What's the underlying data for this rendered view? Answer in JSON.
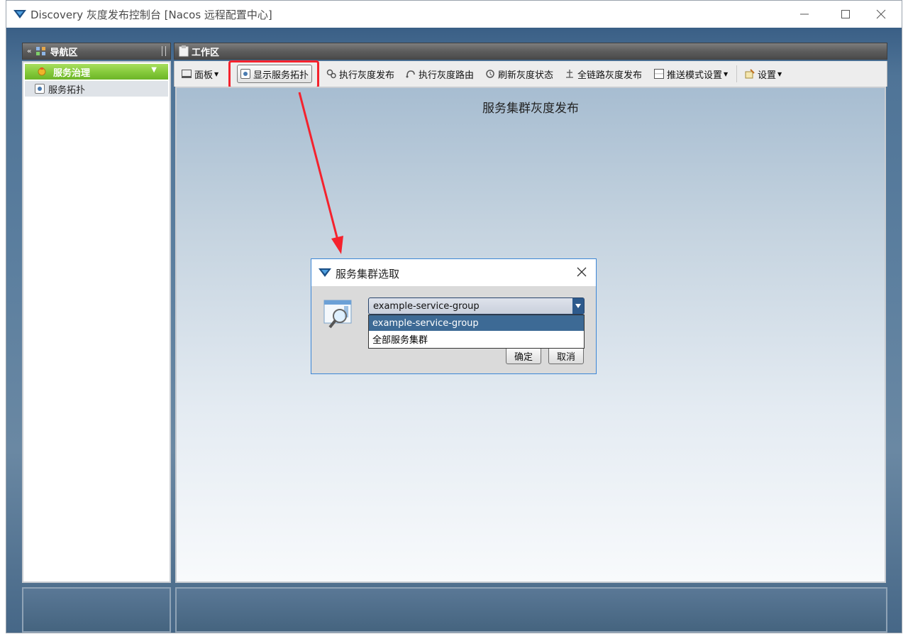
{
  "window": {
    "title": "Discovery 灰度发布控制台 [Nacos 远程配置中心]",
    "controls": [
      "minimize",
      "maximize",
      "close"
    ]
  },
  "nav": {
    "header": "导航区",
    "group": "服务治理",
    "items": [
      {
        "label": "服务拓扑",
        "selected": true
      }
    ]
  },
  "work": {
    "header": "工作区",
    "toolbar": {
      "panel": "面板",
      "show_topology": "显示服务拓扑",
      "exec_release": "执行灰度发布",
      "exec_route": "执行灰度路由",
      "refresh_status": "刷新灰度状态",
      "full_link_release": "全链路灰度发布",
      "push_mode": "推送模式设置",
      "settings": "设置"
    },
    "canvas_title": "服务集群灰度发布"
  },
  "dialog": {
    "title": "服务集群选取",
    "combo_value": "example-service-group",
    "options": [
      "example-service-group",
      "全部服务集群"
    ],
    "selected_option": "example-service-group",
    "ok": "确定",
    "cancel": "取消"
  },
  "colors": {
    "accent_red": "#f5222d",
    "group_green": "#84c93a",
    "selection_blue": "#3d6a95",
    "dialog_border": "#3c86d6"
  },
  "annotation": {
    "highlighted_button": "显示服务拓扑",
    "arrow_points_to": "dialog"
  }
}
